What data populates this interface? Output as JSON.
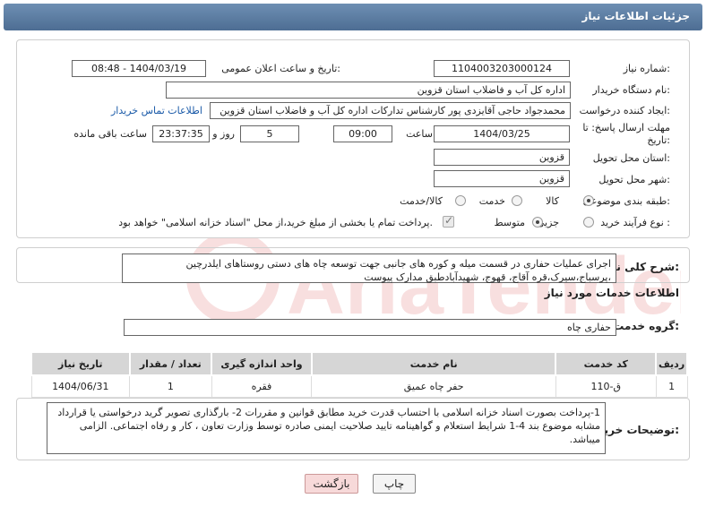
{
  "header": {
    "title": "جزئیات اطلاعات نیاز"
  },
  "form": {
    "need_number_label": "شماره نیاز:",
    "need_number": "1104003203000124",
    "announce_label": "تاریخ و ساعت اعلان عمومی:",
    "announce_value": "1404/03/19 - 08:48",
    "buyer_org_label": "نام دستگاه خریدار:",
    "buyer_org": "اداره کل آب و فاضلاب استان قزوین",
    "creator_label": "ایجاد کننده درخواست:",
    "creator": "محمدجواد حاجی آقایزدی پور کارشناس تدارکات اداره کل آب و فاضلاب استان قزوین",
    "contact_link": "اطلاعات تماس خریدار",
    "deadline_label": "مهلت ارسال پاسخ: تا تاریخ:",
    "deadline_date": "1404/03/25",
    "time_label": "ساعت",
    "deadline_time": "09:00",
    "days_value": "5",
    "days_label": "روز و",
    "remaining_time": "23:37:35",
    "remaining_label": "ساعت باقی مانده",
    "province_label": "استان محل تحویل:",
    "province": "قزوین",
    "city_label": "شهر محل تحویل:",
    "city": "قزوین",
    "category_label": "طبقه بندی موضوعی:",
    "category_options": [
      "کالا",
      "خدمت",
      "کالا/خدمت"
    ],
    "process_label": "نوع فرآیند خرید :",
    "process_options": [
      "جزیی",
      "متوسط"
    ],
    "payment_note": "پرداخت تمام یا بخشی از مبلغ خرید،از محل \"اسناد خزانه اسلامی\" خواهد بود."
  },
  "summary": {
    "label": "شرح کلی نیاز:",
    "text": "اجرای عملیات حفاری در قسمت میله و کوره های جانبی جهت توسعه چاه های دستی روستاهای  ایلدرچین ،پرسباج،سیرک،قره آقاج، قهوج، شهیدآبادطبق مدارک پیوست"
  },
  "services": {
    "section_title": "اطلاعات خدمات مورد نیاز",
    "group_label": "گروه خدمت:",
    "group_value": "حفاری چاه",
    "columns": [
      "ردیف",
      "کد خدمت",
      "نام خدمت",
      "واحد اندازه گیری",
      "تعداد / مقدار",
      "تاریخ نیاز"
    ],
    "rows": [
      [
        "1",
        "ق-110",
        "حفر چاه عمیق",
        "فقره",
        "1",
        "1404/06/31"
      ]
    ]
  },
  "buyer_notes": {
    "label": "توضیحات خریدار:",
    "text": "1-پرداخت بصورت اسناد خزانه اسلامی با احتساب قدرت خرید مطابق قوانین و مقررات 2- بارگذاری تصویر گرید درخواستی یا قرارداد مشابه موضوع بند 4-1 شرایط استعلام و گواهینامه تایید صلاحیت ایمنی صادره توسط وزارت تعاون ، کار و رفاه اجتماعی. الزامی میباشد."
  },
  "buttons": {
    "print": "چاپ",
    "back": "بازگشت"
  },
  "watermark": {
    "text": "AriaTender.neT"
  },
  "colors": {
    "header": "#5b7ba1",
    "link": "#1a5aa8",
    "back_button": "#f7d9d9"
  }
}
